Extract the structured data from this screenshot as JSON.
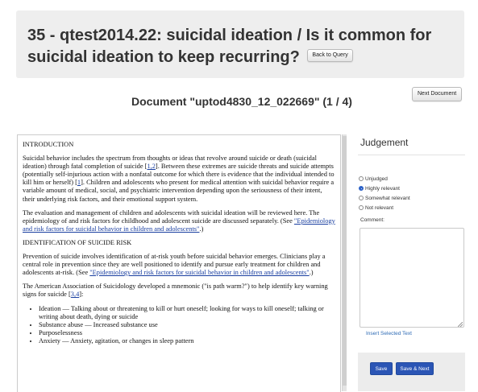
{
  "topic": {
    "title": "35 - qtest2014.22: suicidal ideation / Is it common for suicidal ideation to keep recurring?",
    "back_label": "Back to Query"
  },
  "nav": {
    "next_label": "Next Document"
  },
  "document": {
    "title": "Document \"uptod4830_12_022669\" (1 / 4)",
    "intro_heading": "INTRODUCTION",
    "p1_a": "Suicidal behavior includes the spectrum from thoughts or ideas that revolve around suicide or death (suicidal ideation) through fatal completion of suicide [",
    "p1_ref1": "1,2",
    "p1_b": "]. Between these extremes are suicide threats and suicide attempts (potentially self-injurious action with a nonfatal outcome for which there is evidence that the individual intended to kill him or herself) [",
    "p1_ref2": "1",
    "p1_c": "]. Children and adolescents who present for medical attention with suicidal behavior require a variable amount of medical, social, and psychiatric intervention depending upon the seriousness of their intent, their underlying risk factors, and their emotional support system.",
    "p2_a": "The evaluation and management of children and adolescents with suicidal ideation will be reviewed here. The epidemiology of and risk factors for childhood and adolescent suicide are discussed separately. (See ",
    "p2_link": "\"Epidemiology and risk factors for suicidal behavior in children and adolescents\"",
    "p2_b": ".)",
    "ident_heading": "IDENTIFICATION OF SUICIDE RISK",
    "p3_a": "Prevention of suicide involves identification of at-risk youth before suicidal behavior emerges. Clinicians play a central role in prevention since they are well positioned to identify and pursue early treatment for children and adolescents at-risk. (See ",
    "p3_link": "\"Epidemiology and risk factors for suicidal behavior in children and adolescents\"",
    "p3_b": ".)",
    "p4_a": "The American Association of Suicidology developed a mnemonic (\"is path warm?\") to help identify key warning signs for suicide [",
    "p4_ref": "3,4",
    "p4_b": "]:",
    "bullets": [
      "Ideation — Talking about or threatening to kill or hurt oneself; looking for ways to kill oneself; talking or writing about death, dying or suicide",
      "Substance abuse — Increased substance use",
      "Purposelessness",
      "Anxiety — Anxiety, agitation, or changes in sleep pattern"
    ]
  },
  "judgement": {
    "title": "Judgement",
    "options": [
      "Unjudged",
      "Highly relevant",
      "Somewhat relevant",
      "Not relevant"
    ],
    "selected": "Highly relevant",
    "comment_label": "Comment:",
    "comment_value": "",
    "insert_label": "Insert Selected Text",
    "save_label": "Save",
    "save_next_label": "Save & Next"
  },
  "colors": {
    "accent": "#2b55b5",
    "link": "#1a3fa0",
    "panel_bg": "#eeeeee"
  }
}
